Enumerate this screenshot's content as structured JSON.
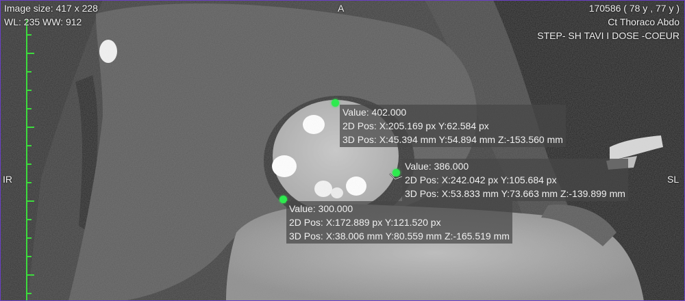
{
  "viewer": {
    "image_size": "Image size: 417 x 228",
    "window_level": "WL: 235 WW: 912",
    "orientation_top": "A",
    "orientation_left": "IR",
    "orientation_right": "SL",
    "patient_id": "170586 ( 78 y , 77 y )",
    "study": "Ct Thoraco Abdo",
    "series": "STEP- SH TAVI I DOSE -COEUR"
  },
  "annotations": [
    {
      "value": "Value: 402.000",
      "pos2d": "2D Pos: X:205.169 px Y:62.584 px",
      "pos3d": "3D Pos: X:45.394 mm Y:54.894 mm Z:-153.560 mm"
    },
    {
      "value": "Value: 386.000",
      "pos2d": "2D Pos: X:242.042 px Y:105.684 px",
      "pos3d": "3D Pos: X:53.833 mm Y:73.663 mm Z:-139.899 mm"
    },
    {
      "value": "Value: 300.000",
      "pos2d": "2D Pos: X:172.889 px Y:121.520 px",
      "pos3d": "3D Pos: X:38.006 mm Y:80.559 mm Z:-165.519 mm"
    }
  ],
  "colors": {
    "roi_marker": "#2eea4e",
    "ruler": "#3ddc3d",
    "viewport_border": "#6b3fc9"
  }
}
